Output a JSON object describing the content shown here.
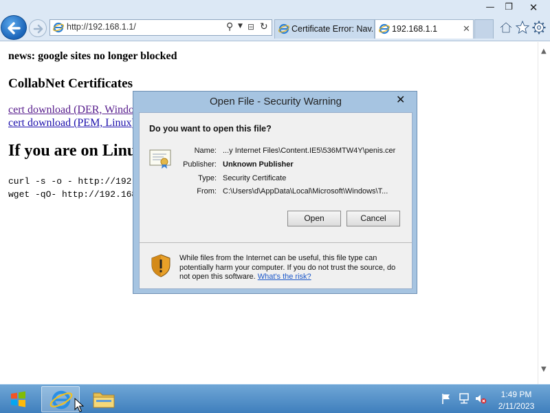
{
  "browser": {
    "address": "http://192.168.1.1/",
    "tabs": [
      {
        "label": "Certificate Error: Nav..."
      },
      {
        "label": "192.168.1.1"
      }
    ]
  },
  "page": {
    "news": "news: google sites no longer blocked",
    "certs_heading": "CollabNet Certificates",
    "link_der": "cert download (DER, Windows)",
    "link_pem": "cert download (PEM, Linux)",
    "linux_heading": "If you are on Linux",
    "curl_cmd": "curl -s -o - http://192.168.1.1/",
    "wget_cmd": "wget -qO- http://192.168.1.1/"
  },
  "dialog": {
    "title": "Open File - Security Warning",
    "question": "Do you want to open this file?",
    "fields": {
      "name_label": "Name:",
      "name_value": "...y Internet Files\\Content.IE5\\536MTW4Y\\penis.cer",
      "publisher_label": "Publisher:",
      "publisher_value": "Unknown Publisher",
      "type_label": "Type:",
      "type_value": "Security Certificate",
      "from_label": "From:",
      "from_value": "C:\\Users\\d\\AppData\\Local\\Microsoft\\Windows\\T..."
    },
    "open_label": "Open",
    "cancel_label": "Cancel",
    "close_glyph": "✕",
    "warning_text": "While files from the Internet can be useful, this file type can potentially harm your computer. If you do not trust the source, do not open this software. ",
    "risk_link": "What's the risk?"
  },
  "taskbar": {
    "time": "1:49 PM",
    "date": "2/11/2023"
  },
  "colors": {
    "chrome": "#dce8f5",
    "dialog_frame": "#a6c4e1",
    "taskbar": "#3f7fbd",
    "link_visited": "#551a8b",
    "link": "#1a0dab"
  },
  "icons": [
    "back-arrow-icon",
    "forward-arrow-icon",
    "ie-icon",
    "search-icon",
    "refresh-icon",
    "home-icon",
    "star-icon",
    "gear-icon",
    "certificate-icon",
    "shield-icon",
    "windows-logo-icon",
    "folder-icon",
    "flag-icon",
    "network-icon",
    "sound-icon",
    "cursor-icon"
  ]
}
